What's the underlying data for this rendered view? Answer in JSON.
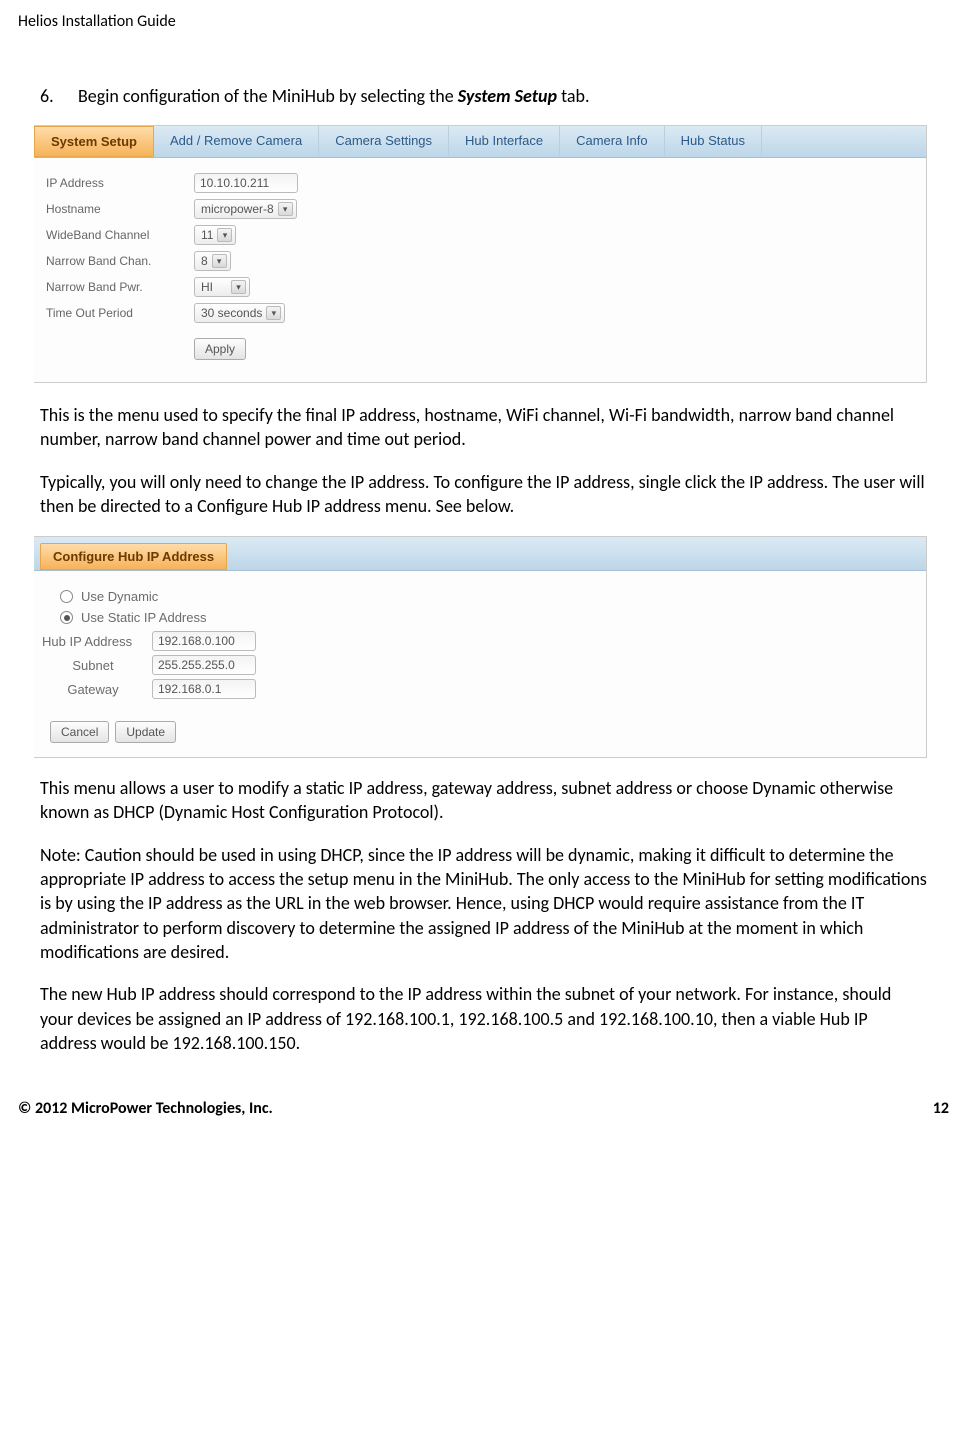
{
  "header": {
    "title": "Helios Installation Guide"
  },
  "step": {
    "number": "6.",
    "pre": "Begin configuration of the MiniHub by selecting the ",
    "bold": "System Setup",
    "post": " tab."
  },
  "tabs": [
    "System Setup",
    "Add / Remove Camera",
    "Camera Settings",
    "Hub Interface",
    "Camera Info",
    "Hub Status"
  ],
  "systemSetup": {
    "fields": {
      "ip_label": "IP Address",
      "ip_value": "10.10.10.211",
      "host_label": "Hostname",
      "host_value": "micropower-8",
      "wb_label": "WideBand Channel",
      "wb_value": "11",
      "nbc_label": "Narrow Band Chan.",
      "nbc_value": "8",
      "nbp_label": "Narrow Band Pwr.",
      "nbp_value": "HI",
      "to_label": "Time Out Period",
      "to_value": "30 seconds"
    },
    "apply": "Apply"
  },
  "para1": "This is the menu used to specify the final IP address, hostname, WiFi channel, Wi-Fi bandwidth, narrow band channel number, narrow band channel power and time out period.",
  "para2": "Typically, you will only need to change the IP address.   To configure the IP address, single click the IP address.   The user will then be directed to a Configure Hub IP address menu.   See below.",
  "configHub": {
    "title": "Configure Hub IP Address",
    "opt1": "Use Dynamic",
    "opt2": "Use Static IP Address",
    "hubip_label": "Hub IP Address",
    "hubip_value": "192.168.0.100",
    "subnet_label": "Subnet",
    "subnet_value": "255.255.255.0",
    "gateway_label": "Gateway",
    "gateway_value": "192.168.0.1",
    "cancel": "Cancel",
    "update": "Update"
  },
  "para3": "This menu allows a user to modify a static IP address, gateway address, subnet address or choose Dynamic otherwise known as DHCP (Dynamic Host Configuration Protocol).",
  "para4": "Note:  Caution should be used in using DHCP, since the IP address will be dynamic, making it difficult to determine the appropriate IP address to access the setup menu in the MiniHub.   The only access to the MiniHub for setting modifications is by using the IP address as the URL in the web browser.   Hence, using DHCP would require assistance from the IT administrator to perform discovery to determine the assigned IP address of the MiniHub at the moment in which modifications are desired.",
  "para5": "The new Hub IP address should correspond to the IP address within the subnet of your network.   For instance, should your devices be assigned an IP address of 192.168.100.1, 192.168.100.5 and 192.168.100.10, then a viable Hub IP address would be 192.168.100.150.",
  "footer": {
    "copyright": "© 2012 MicroPower Technologies, Inc.",
    "page": "12"
  }
}
